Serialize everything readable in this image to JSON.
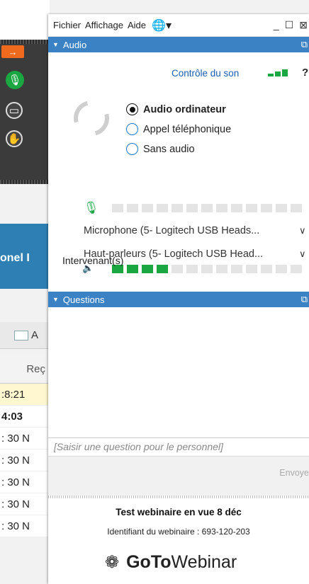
{
  "menu": {
    "fichier": "Fichier",
    "affichage": "Affichage",
    "aide": "Aide"
  },
  "audio": {
    "section_title": "Audio",
    "sound_control": "Contrôle du son",
    "options": [
      "Audio ordinateur",
      "Appel téléphonique",
      "Sans audio"
    ],
    "selected_option": "Audio ordinateur",
    "microphone": "Microphone (5- Logitech USB Heads...",
    "speakers": "Haut-parleurs (5- Logitech USB Head...",
    "mic_level_segments_lit": 0,
    "speaker_level_segments_lit": 4,
    "level_segments_total": 13,
    "speakers_label": "Intervenant(s)"
  },
  "questions": {
    "section_title": "Questions",
    "input_placeholder": "[Saisir une question pour le personnel]",
    "send_label": "Envoye"
  },
  "webinar": {
    "title": "Test webinaire en vue 8 déc",
    "id_line": "Identifiant du webinaire : 693-120-203",
    "logo_bold": "GoTo",
    "logo_rest": "Webinar"
  },
  "background_app": {
    "band_text": "onel I",
    "toolbar_text": "A",
    "header_text": "Reç",
    "rows": [
      ":8:21",
      "4:03",
      ": 30 N",
      ": 30 N",
      ": 30 N",
      ": 30 N",
      ": 30 N"
    ]
  },
  "colors": {
    "accent": "#3b82c4",
    "green": "#1aa640",
    "link": "#1b5fb1"
  }
}
